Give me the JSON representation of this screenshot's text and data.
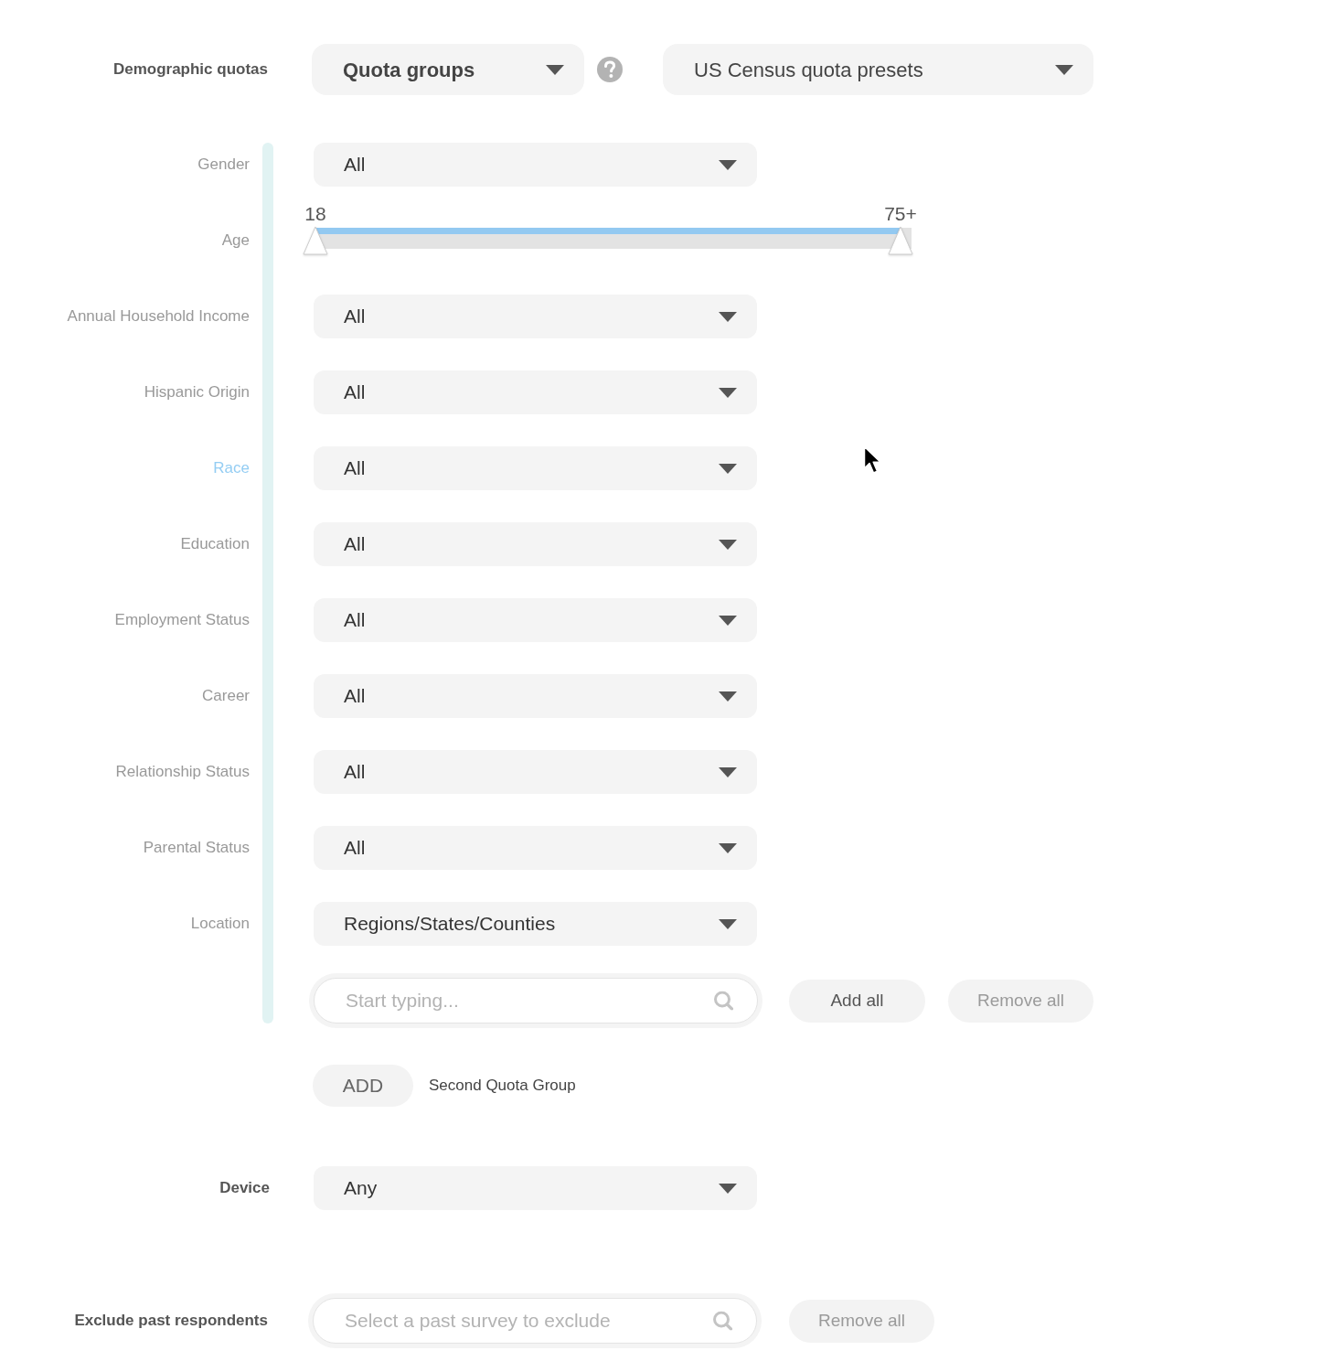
{
  "demographic_quotas": {
    "label": "Demographic quotas",
    "quota_mode": {
      "value": "Quota groups"
    },
    "presets": {
      "value": "US Census quota presets"
    }
  },
  "quota_group": {
    "rows": [
      {
        "kind": "dropdown",
        "label": "Gender",
        "selected": false,
        "value": "All"
      },
      {
        "kind": "range",
        "label": "Age",
        "selected": false,
        "thumbs": [
          {
            "label": "18",
            "level": 0
          },
          {
            "label": "75+",
            "level": 1
          }
        ]
      },
      {
        "kind": "dropdown",
        "label": "Annual Household Income",
        "selected": false,
        "value": "All"
      },
      {
        "kind": "dropdown",
        "label": "Hispanic Origin",
        "selected": false,
        "value": "All"
      },
      {
        "kind": "dropdown",
        "label": "Race",
        "selected": true,
        "value": "All"
      },
      {
        "kind": "dropdown",
        "label": "Education",
        "selected": false,
        "value": "All"
      },
      {
        "kind": "dropdown",
        "label": "Employment Status",
        "selected": false,
        "value": "All"
      },
      {
        "kind": "dropdown",
        "label": "Career",
        "selected": false,
        "value": "All"
      },
      {
        "kind": "dropdown",
        "label": "Relationship Status",
        "selected": false,
        "value": "All"
      },
      {
        "kind": "dropdown",
        "label": "Parental Status",
        "selected": false,
        "value": "All"
      },
      {
        "kind": "dropdown",
        "label": "Location",
        "selected": false,
        "value": "Regions/States/Counties"
      }
    ],
    "location_search": {
      "placeholder": "Start typing..."
    },
    "buttons": [
      {
        "label": "Add all",
        "disabled": false
      },
      {
        "label": "Remove all",
        "disabled": true
      }
    ]
  },
  "add_group": {
    "button": "ADD",
    "label": "Second Quota Group"
  },
  "device": {
    "label": "Device",
    "value": "Any"
  },
  "exclude_past_respondents": {
    "label": "Exclude past respondents",
    "placeholder": "Select a past survey to exclude",
    "buttons": [
      {
        "label": "Remove all",
        "disabled": true
      }
    ]
  }
}
